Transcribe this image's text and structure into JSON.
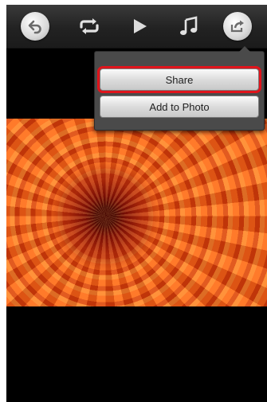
{
  "toolbar": {
    "buttons": [
      {
        "name": "back",
        "icon": "back-arrow-icon"
      },
      {
        "name": "repeat",
        "icon": "repeat-icon"
      },
      {
        "name": "play",
        "icon": "play-icon"
      },
      {
        "name": "music",
        "icon": "music-note-icon"
      },
      {
        "name": "share",
        "icon": "share-icon"
      }
    ]
  },
  "share_menu": {
    "share_label": "Share",
    "add_to_photo_label": "Add to Photo",
    "highlight_color": "#e0141b"
  },
  "photo": {
    "subject": "orange chrysanthemum",
    "accent": "#e2531a"
  }
}
